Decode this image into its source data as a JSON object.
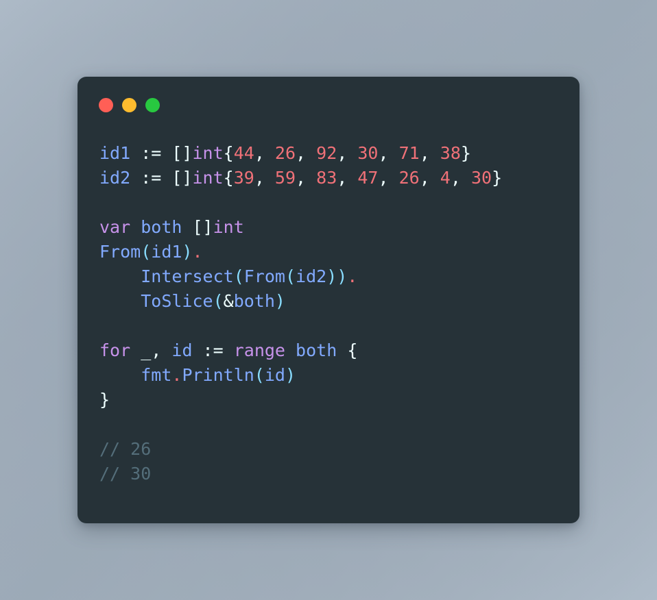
{
  "window": {
    "card_label": "code-snippet-card",
    "background_color": "#263238",
    "traffic_lights": [
      {
        "name": "close",
        "label": "Close",
        "color": "#ff5f56"
      },
      {
        "name": "minimize",
        "label": "Minimize",
        "color": "#febc2e"
      },
      {
        "name": "maximize",
        "label": "Maximize",
        "color": "#28c840"
      }
    ]
  },
  "theme": {
    "page_background_start": "#b4c1ce",
    "page_background_end": "#9dabb8",
    "text": "#eeffff",
    "keyword": "#c792ea",
    "variable": "#82aaff",
    "number": "#f07178",
    "operator": "#f07178",
    "paren": "#89ddff",
    "comment": "#546e7a"
  },
  "code": {
    "language": "go",
    "font_size_px": 25,
    "line_height_px": 36,
    "lines": [
      {
        "n": 1,
        "text": "id1 := []int{44, 26, 92, 30, 71, 38}",
        "tokens": [
          {
            "t": "id1",
            "c": "t-var"
          },
          {
            "t": " := ",
            "c": "t-punct"
          },
          {
            "t": "[]",
            "c": "t-punct"
          },
          {
            "t": "int",
            "c": "t-type"
          },
          {
            "t": "{",
            "c": "t-punct"
          },
          {
            "t": "44",
            "c": "t-num"
          },
          {
            "t": ", ",
            "c": "t-punct"
          },
          {
            "t": "26",
            "c": "t-num"
          },
          {
            "t": ", ",
            "c": "t-punct"
          },
          {
            "t": "92",
            "c": "t-num"
          },
          {
            "t": ", ",
            "c": "t-punct"
          },
          {
            "t": "30",
            "c": "t-num"
          },
          {
            "t": ", ",
            "c": "t-punct"
          },
          {
            "t": "71",
            "c": "t-num"
          },
          {
            "t": ", ",
            "c": "t-punct"
          },
          {
            "t": "38",
            "c": "t-num"
          },
          {
            "t": "}",
            "c": "t-punct"
          }
        ]
      },
      {
        "n": 2,
        "text": "id2 := []int{39, 59, 83, 47, 26, 4, 30}",
        "tokens": [
          {
            "t": "id2",
            "c": "t-var"
          },
          {
            "t": " := ",
            "c": "t-punct"
          },
          {
            "t": "[]",
            "c": "t-punct"
          },
          {
            "t": "int",
            "c": "t-type"
          },
          {
            "t": "{",
            "c": "t-punct"
          },
          {
            "t": "39",
            "c": "t-num"
          },
          {
            "t": ", ",
            "c": "t-punct"
          },
          {
            "t": "59",
            "c": "t-num"
          },
          {
            "t": ", ",
            "c": "t-punct"
          },
          {
            "t": "83",
            "c": "t-num"
          },
          {
            "t": ", ",
            "c": "t-punct"
          },
          {
            "t": "47",
            "c": "t-num"
          },
          {
            "t": ", ",
            "c": "t-punct"
          },
          {
            "t": "26",
            "c": "t-num"
          },
          {
            "t": ", ",
            "c": "t-punct"
          },
          {
            "t": "4",
            "c": "t-num"
          },
          {
            "t": ", ",
            "c": "t-punct"
          },
          {
            "t": "30",
            "c": "t-num"
          },
          {
            "t": "}",
            "c": "t-punct"
          }
        ]
      },
      {
        "n": 3,
        "text": "",
        "tokens": []
      },
      {
        "n": 4,
        "text": "var both []int",
        "tokens": [
          {
            "t": "var",
            "c": "t-kw"
          },
          {
            "t": " ",
            "c": "t-punct"
          },
          {
            "t": "both",
            "c": "t-var"
          },
          {
            "t": " ",
            "c": "t-punct"
          },
          {
            "t": "[]",
            "c": "t-punct"
          },
          {
            "t": "int",
            "c": "t-type"
          }
        ]
      },
      {
        "n": 5,
        "text": "From(id1).",
        "tokens": [
          {
            "t": "From",
            "c": "t-fn"
          },
          {
            "t": "(",
            "c": "t-paren"
          },
          {
            "t": "id1",
            "c": "t-var"
          },
          {
            "t": ")",
            "c": "t-paren"
          },
          {
            "t": ".",
            "c": "t-dot"
          }
        ]
      },
      {
        "n": 6,
        "text": "    Intersect(From(id2)).",
        "tokens": [
          {
            "t": "    ",
            "c": "t-punct"
          },
          {
            "t": "Intersect",
            "c": "t-fn"
          },
          {
            "t": "(",
            "c": "t-paren"
          },
          {
            "t": "From",
            "c": "t-fn"
          },
          {
            "t": "(",
            "c": "t-paren"
          },
          {
            "t": "id2",
            "c": "t-var"
          },
          {
            "t": "))",
            "c": "t-paren"
          },
          {
            "t": ".",
            "c": "t-dot"
          }
        ]
      },
      {
        "n": 7,
        "text": "    ToSlice(&both)",
        "tokens": [
          {
            "t": "    ",
            "c": "t-punct"
          },
          {
            "t": "ToSlice",
            "c": "t-fn"
          },
          {
            "t": "(",
            "c": "t-paren"
          },
          {
            "t": "&",
            "c": "t-punct"
          },
          {
            "t": "both",
            "c": "t-var"
          },
          {
            "t": ")",
            "c": "t-paren"
          }
        ]
      },
      {
        "n": 8,
        "text": "",
        "tokens": []
      },
      {
        "n": 9,
        "text": "for _, id := range both {",
        "tokens": [
          {
            "t": "for",
            "c": "t-kw"
          },
          {
            "t": " ",
            "c": "t-punct"
          },
          {
            "t": "_",
            "c": "t-punct"
          },
          {
            "t": ", ",
            "c": "t-punct"
          },
          {
            "t": "id",
            "c": "t-var"
          },
          {
            "t": " := ",
            "c": "t-punct"
          },
          {
            "t": "range",
            "c": "t-kw"
          },
          {
            "t": " ",
            "c": "t-punct"
          },
          {
            "t": "both",
            "c": "t-var"
          },
          {
            "t": " {",
            "c": "t-punct"
          }
        ]
      },
      {
        "n": 10,
        "text": "    fmt.Println(id)",
        "tokens": [
          {
            "t": "    ",
            "c": "t-punct"
          },
          {
            "t": "fmt",
            "c": "t-fn"
          },
          {
            "t": ".",
            "c": "t-dot"
          },
          {
            "t": "Println",
            "c": "t-fn"
          },
          {
            "t": "(",
            "c": "t-paren"
          },
          {
            "t": "id",
            "c": "t-var"
          },
          {
            "t": ")",
            "c": "t-paren"
          }
        ]
      },
      {
        "n": 11,
        "text": "}",
        "tokens": [
          {
            "t": "}",
            "c": "t-punct"
          }
        ]
      },
      {
        "n": 12,
        "text": "",
        "tokens": []
      },
      {
        "n": 13,
        "text": "// 26",
        "tokens": [
          {
            "t": "// 26",
            "c": "t-comment"
          }
        ]
      },
      {
        "n": 14,
        "text": "// 30",
        "tokens": [
          {
            "t": "// 30",
            "c": "t-comment"
          }
        ]
      }
    ]
  }
}
